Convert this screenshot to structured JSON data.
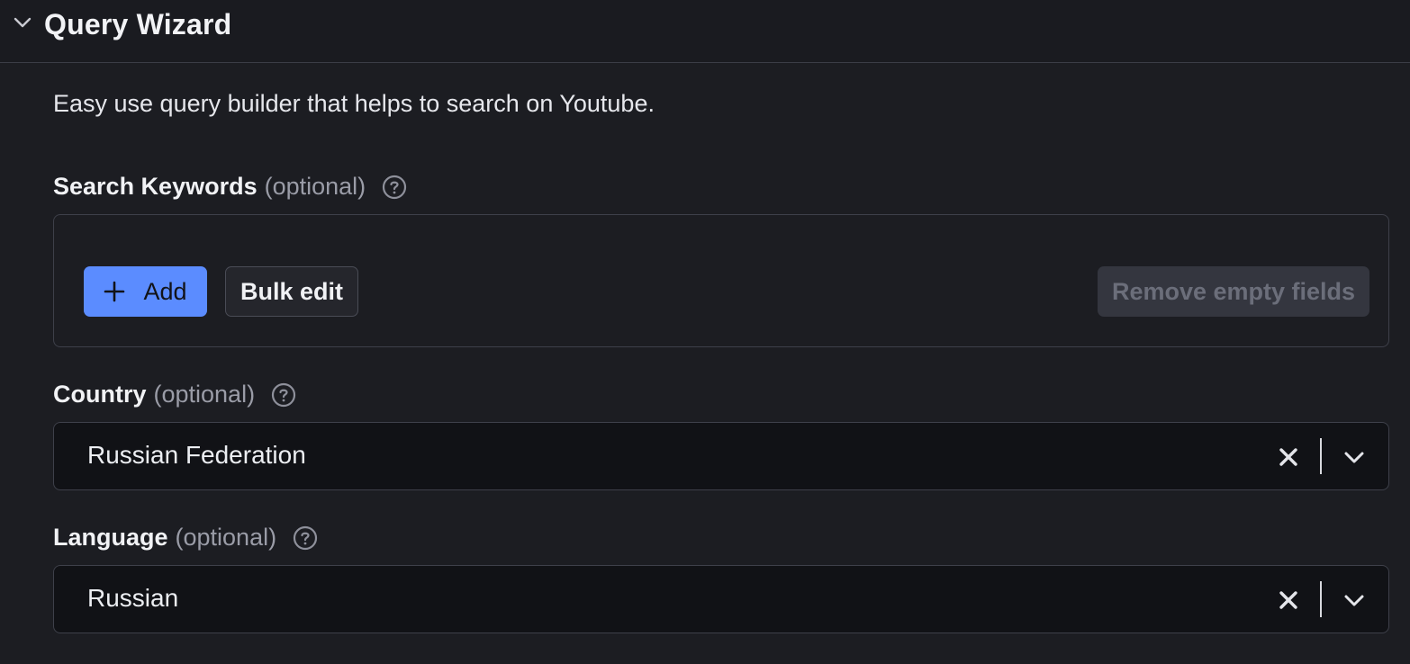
{
  "header": {
    "title": "Query Wizard",
    "collapse_icon": "chevron-down-icon"
  },
  "description": "Easy use query builder that helps to search on Youtube.",
  "keywords": {
    "label": "Search Keywords",
    "optional": "(optional)",
    "help_icon": "help-circle-icon",
    "add_label": "Add",
    "bulk_label": "Bulk edit",
    "remove_label": "Remove empty fields"
  },
  "country": {
    "label": "Country",
    "optional": "(optional)",
    "help_icon": "help-circle-icon",
    "value": "Russian Federation"
  },
  "language": {
    "label": "Language",
    "optional": "(optional)",
    "help_icon": "help-circle-icon",
    "value": "Russian"
  },
  "colors": {
    "background": "#1c1d22",
    "accent": "#5b8cff",
    "field_bg": "#111216",
    "muted_text": "#9a9ca7"
  }
}
